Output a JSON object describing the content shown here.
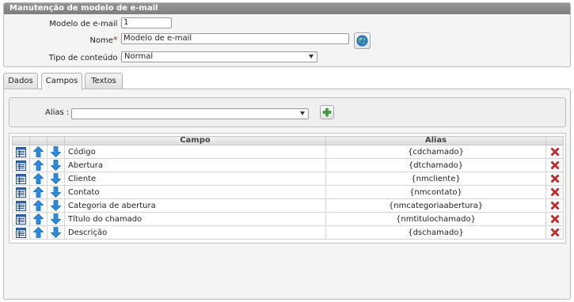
{
  "form": {
    "title": "Manutenção de modelo de e-mail",
    "modelo_label": "Modelo de e-mail :",
    "modelo_value": "1",
    "nome_label": "Nome",
    "nome_required_mark": "*",
    "nome_suffix": " :",
    "nome_value": "Modelo de e-mail",
    "tipo_label": "Tipo de conteúdo :",
    "tipo_value": "Normal"
  },
  "tabs": [
    {
      "label": "Dados",
      "active": false
    },
    {
      "label": "Campos",
      "active": true
    },
    {
      "label": "Textos",
      "active": false
    }
  ],
  "alias_filter": {
    "label": "Alias :",
    "value": ""
  },
  "table": {
    "headers": [
      "Campo",
      "Alias"
    ],
    "rows": [
      {
        "campo": "Código",
        "alias": "{cdchamado}"
      },
      {
        "campo": "Abertura",
        "alias": "{dtchamado}"
      },
      {
        "campo": "Cliente",
        "alias": "{nmcliente}"
      },
      {
        "campo": "Contato",
        "alias": "{nmcontato}"
      },
      {
        "campo": "Categoria de abertura",
        "alias": "{nmcategoriaabertura}"
      },
      {
        "campo": "Título do chamado",
        "alias": "{nmtitulochamado}"
      },
      {
        "campo": "Descrição",
        "alias": "{dschamado}"
      }
    ]
  },
  "icons": {
    "details": "table-details-icon",
    "up": "arrow-up-icon",
    "down": "arrow-down-icon",
    "delete": "delete-x-icon",
    "add": "add-plus-icon",
    "globe": "globe-icon"
  },
  "colors": {
    "header_bar": "#8a8a8a",
    "arrow_blue": "#2a8be0",
    "delete_red": "#d22b2b",
    "add_green": "#3aa83a",
    "required_red": "#dd1111"
  }
}
